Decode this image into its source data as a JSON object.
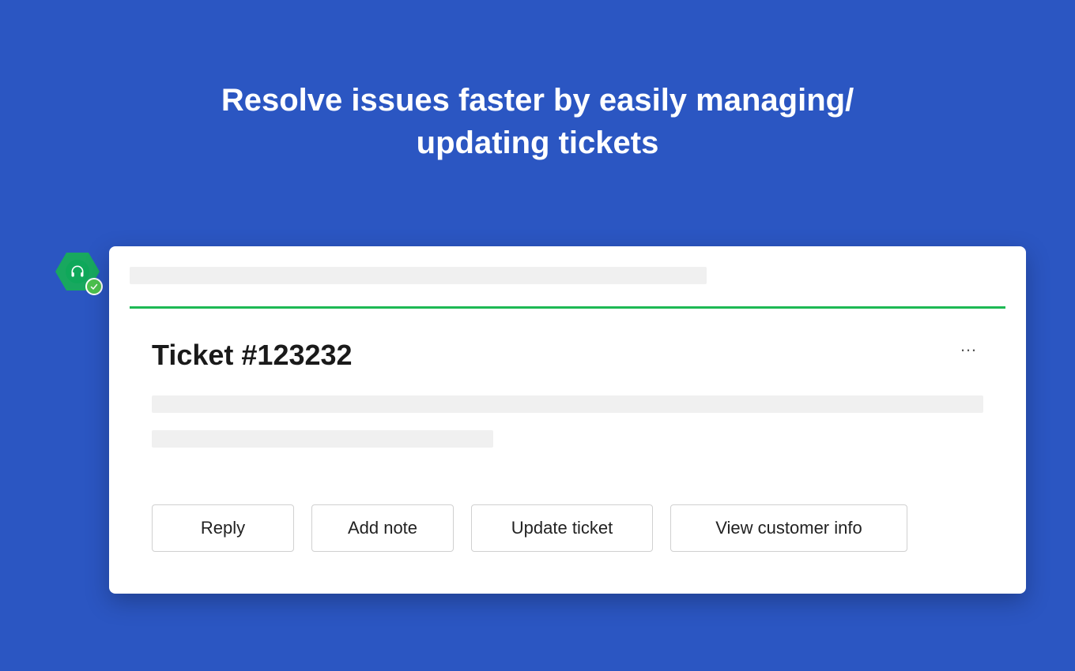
{
  "hero": {
    "title": "Resolve issues faster by easily managing/ updating tickets"
  },
  "card": {
    "ticket_title": "Ticket #123232",
    "more_label": "…",
    "actions": {
      "reply": "Reply",
      "add_note": "Add note",
      "update_ticket": "Update ticket",
      "view_customer_info": "View customer info"
    }
  },
  "badge": {
    "icon": "headset-icon",
    "status": "verified"
  },
  "colors": {
    "background": "#2b56c2",
    "accent_green": "#1db954",
    "badge_green": "#18a85f"
  }
}
